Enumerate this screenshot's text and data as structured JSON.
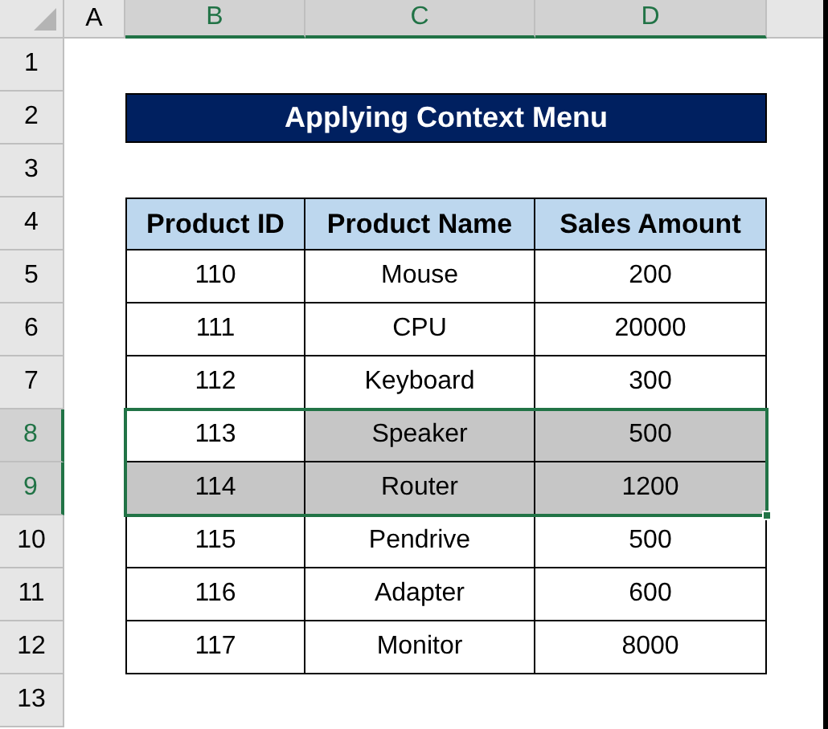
{
  "column_headers": [
    {
      "label": "A",
      "selected": false
    },
    {
      "label": "B",
      "selected": true
    },
    {
      "label": "C",
      "selected": true
    },
    {
      "label": "D",
      "selected": true
    }
  ],
  "row_headers": [
    {
      "label": "1",
      "selected": false
    },
    {
      "label": "2",
      "selected": false
    },
    {
      "label": "3",
      "selected": false
    },
    {
      "label": "4",
      "selected": false
    },
    {
      "label": "5",
      "selected": false
    },
    {
      "label": "6",
      "selected": false
    },
    {
      "label": "7",
      "selected": false
    },
    {
      "label": "8",
      "selected": true
    },
    {
      "label": "9",
      "selected": true
    },
    {
      "label": "10",
      "selected": false
    },
    {
      "label": "11",
      "selected": false
    },
    {
      "label": "12",
      "selected": false
    },
    {
      "label": "13",
      "selected": false
    }
  ],
  "title": "Applying Context Menu",
  "table": {
    "columns": [
      "Product ID",
      "Product Name",
      "Sales Amount"
    ],
    "rows": [
      {
        "cells": [
          {
            "text": "110",
            "selected": false
          },
          {
            "text": "Mouse",
            "selected": false
          },
          {
            "text": "200",
            "selected": false
          }
        ]
      },
      {
        "cells": [
          {
            "text": "111",
            "selected": false
          },
          {
            "text": "CPU",
            "selected": false
          },
          {
            "text": "20000",
            "selected": false
          }
        ]
      },
      {
        "cells": [
          {
            "text": "112",
            "selected": false
          },
          {
            "text": "Keyboard",
            "selected": false
          },
          {
            "text": "300",
            "selected": false
          }
        ]
      },
      {
        "cells": [
          {
            "text": "113",
            "selected": false
          },
          {
            "text": "Speaker",
            "selected": true
          },
          {
            "text": "500",
            "selected": true
          }
        ]
      },
      {
        "cells": [
          {
            "text": "114",
            "selected": true
          },
          {
            "text": "Router",
            "selected": true
          },
          {
            "text": "1200",
            "selected": true
          }
        ]
      },
      {
        "cells": [
          {
            "text": "115",
            "selected": false
          },
          {
            "text": "Pendrive",
            "selected": false
          },
          {
            "text": "500",
            "selected": false
          }
        ]
      },
      {
        "cells": [
          {
            "text": "116",
            "selected": false
          },
          {
            "text": "Adapter",
            "selected": false
          },
          {
            "text": "600",
            "selected": false
          }
        ]
      },
      {
        "cells": [
          {
            "text": "117",
            "selected": false
          },
          {
            "text": "Monitor",
            "selected": false
          },
          {
            "text": "8000",
            "selected": false
          }
        ]
      }
    ]
  }
}
